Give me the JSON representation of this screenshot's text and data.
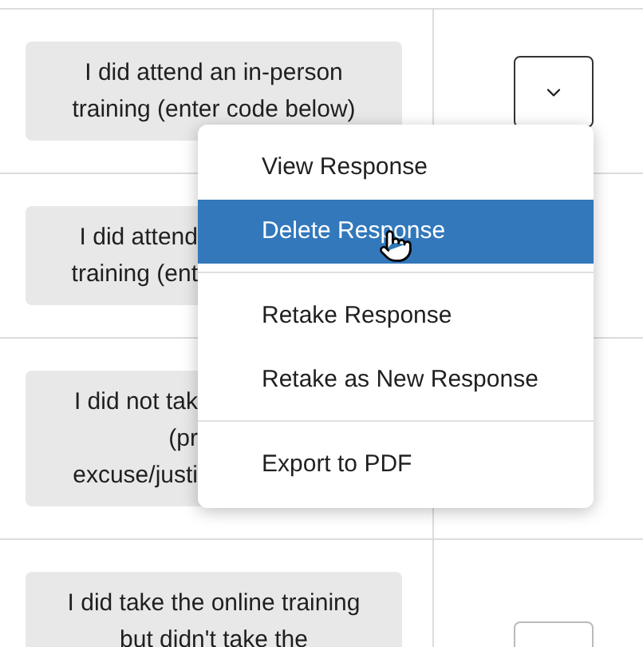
{
  "rows": [
    {
      "lines": [
        "I did attend an in-person",
        "training (enter code below)"
      ],
      "covered": false,
      "expanded": true
    },
    {
      "lines": [
        "I did attend",
        "training (ent"
      ],
      "covered": true
    },
    {
      "lines": [
        "I did not tak",
        "(pr",
        "excuse/justi"
      ],
      "covered": true
    },
    {
      "lines": [
        "I did take the online training",
        "but didn't take the"
      ],
      "covered": false,
      "expanded": false
    }
  ],
  "menu": {
    "groups": [
      [
        {
          "label": "View Response",
          "selected": false
        },
        {
          "label": "Delete Response",
          "selected": true
        }
      ],
      [
        {
          "label": "Retake Response",
          "selected": false
        },
        {
          "label": "Retake as New Response",
          "selected": false
        }
      ],
      [
        {
          "label": "Export to PDF",
          "selected": false
        }
      ]
    ]
  }
}
